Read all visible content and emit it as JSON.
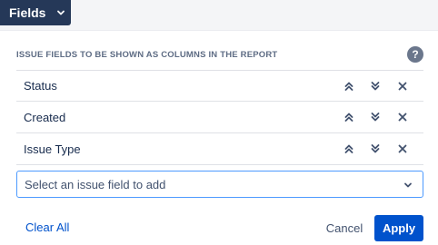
{
  "toolbar": {
    "fields_label": "Fields",
    "fields_icon": "chevron-down-icon"
  },
  "panel": {
    "heading": "ISSUE FIELDS TO BE SHOWN AS COLUMNS IN THE REPORT",
    "help_icon_glyph": "?",
    "fields": [
      {
        "label": "Status"
      },
      {
        "label": "Created"
      },
      {
        "label": "Issue Type"
      }
    ],
    "row_icons": [
      "move-up-icon",
      "move-down-icon",
      "remove-icon"
    ],
    "add_select": {
      "placeholder": "Select an issue field to add",
      "icon": "chevron-down-icon"
    }
  },
  "footer": {
    "clear_all": "Clear All",
    "cancel": "Cancel",
    "apply": "Apply"
  },
  "colors": {
    "toolbar_button": "#253858",
    "primary": "#0052cc",
    "focus_border": "#4c9aff",
    "icon": "#42526e"
  }
}
